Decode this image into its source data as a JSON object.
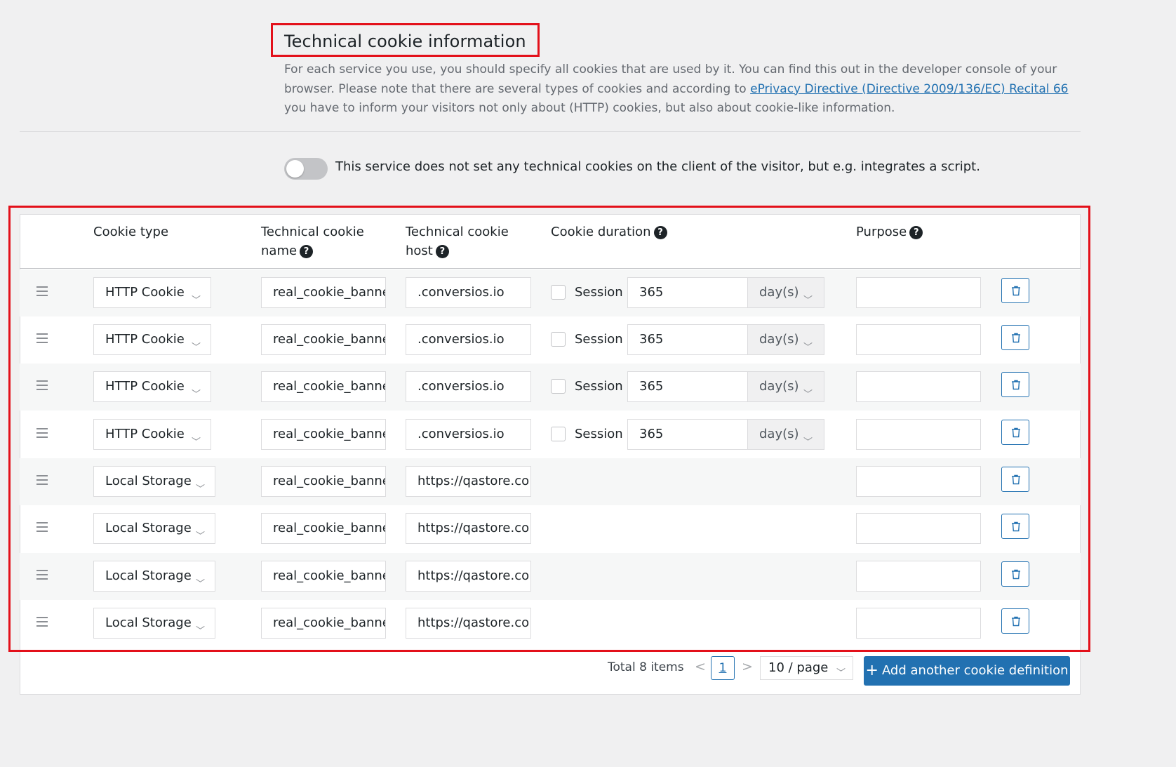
{
  "section": {
    "title": "Technical cookie information",
    "desc_part1": "For each service you use, you should specify all cookies that are used by it. You can find this out in the developer console of your browser. Please note that there are several types of cookies and according to ",
    "desc_link": "ePrivacy Directive (Directive 2009/136/EC) Recital 66",
    "desc_part2": " you have to inform your visitors not only about (HTTP) cookies, but also about cookie-like information."
  },
  "toggle": {
    "label": "This service does not set any technical cookies on the client of the visitor, but e.g. integrates a script.",
    "enabled": false
  },
  "table": {
    "headers": {
      "cookie_type": "Cookie type",
      "name_line1": "Technical cookie",
      "name_line2": "name",
      "host_line1": "Technical cookie",
      "host_line2": "host",
      "duration": "Cookie duration",
      "purpose": "Purpose"
    },
    "help_glyph": "?",
    "session_label": "Session",
    "rows": [
      {
        "type": "HTTP Cookie",
        "name": "real_cookie_banner",
        "host": ".conversios.io",
        "duration": "365",
        "unit": "day(s)",
        "purpose": ""
      },
      {
        "type": "HTTP Cookie",
        "name": "real_cookie_banner",
        "host": ".conversios.io",
        "duration": "365",
        "unit": "day(s)",
        "purpose": ""
      },
      {
        "type": "HTTP Cookie",
        "name": "real_cookie_banner",
        "host": ".conversios.io",
        "duration": "365",
        "unit": "day(s)",
        "purpose": ""
      },
      {
        "type": "HTTP Cookie",
        "name": "real_cookie_banner",
        "host": ".conversios.io",
        "duration": "365",
        "unit": "day(s)",
        "purpose": ""
      },
      {
        "type": "Local Storage",
        "name": "real_cookie_banner",
        "host": "https://qastore.co",
        "purpose": ""
      },
      {
        "type": "Local Storage",
        "name": "real_cookie_banner",
        "host": "https://qastore.co",
        "purpose": ""
      },
      {
        "type": "Local Storage",
        "name": "real_cookie_banner",
        "host": "https://qastore.co",
        "purpose": ""
      },
      {
        "type": "Local Storage",
        "name": "real_cookie_banner",
        "host": "https://qastore.co",
        "purpose": ""
      }
    ]
  },
  "pagination": {
    "total": "Total 8 items",
    "prev": "<",
    "next": ">",
    "current": "1",
    "page_size": "10 / page"
  },
  "add_button": {
    "icon": "+",
    "label": "Add another cookie definition"
  },
  "colors": {
    "accent": "#2271b1",
    "highlight": "#e3101a",
    "background": "#f0f0f1"
  }
}
